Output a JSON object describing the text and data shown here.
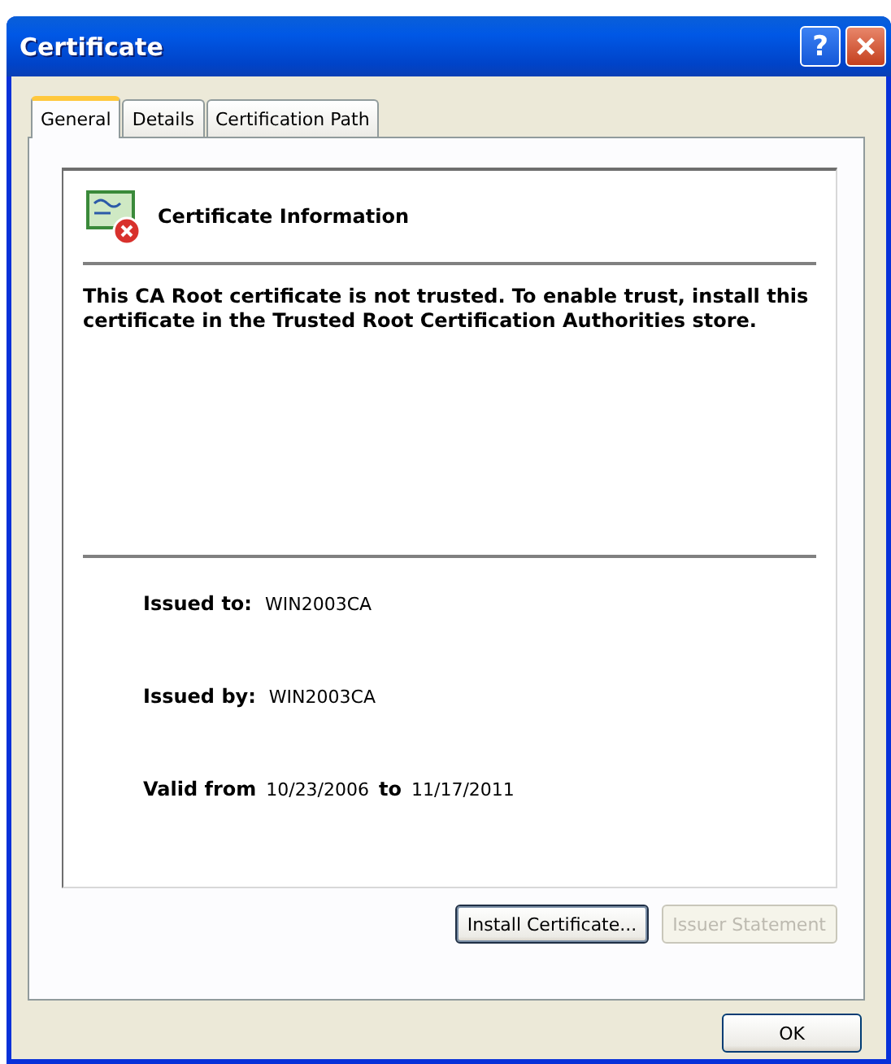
{
  "window": {
    "title": "Certificate",
    "help_label": "?"
  },
  "tabs": [
    {
      "label": "General",
      "selected": true
    },
    {
      "label": "Details",
      "selected": false
    },
    {
      "label": "Certification Path",
      "selected": false
    }
  ],
  "heading": "Certificate Information",
  "message": "This CA Root certificate is not trusted. To enable trust, install this certificate in the Trusted Root Certification Authorities store.",
  "fields": [
    {
      "label": "Issued to:",
      "value": "WIN2003CA"
    },
    {
      "label": "Issued by:",
      "value": "WIN2003CA"
    }
  ],
  "validity": {
    "from_label": "Valid from",
    "from": "10/23/2006",
    "to_label": "to",
    "to": "11/17/2011"
  },
  "buttons": [
    {
      "label": "Install Certificate...",
      "disabled": false,
      "focused": true
    },
    {
      "label": "Issuer Statement",
      "disabled": true,
      "focused": false
    }
  ],
  "ok": {
    "label": "OK"
  }
}
